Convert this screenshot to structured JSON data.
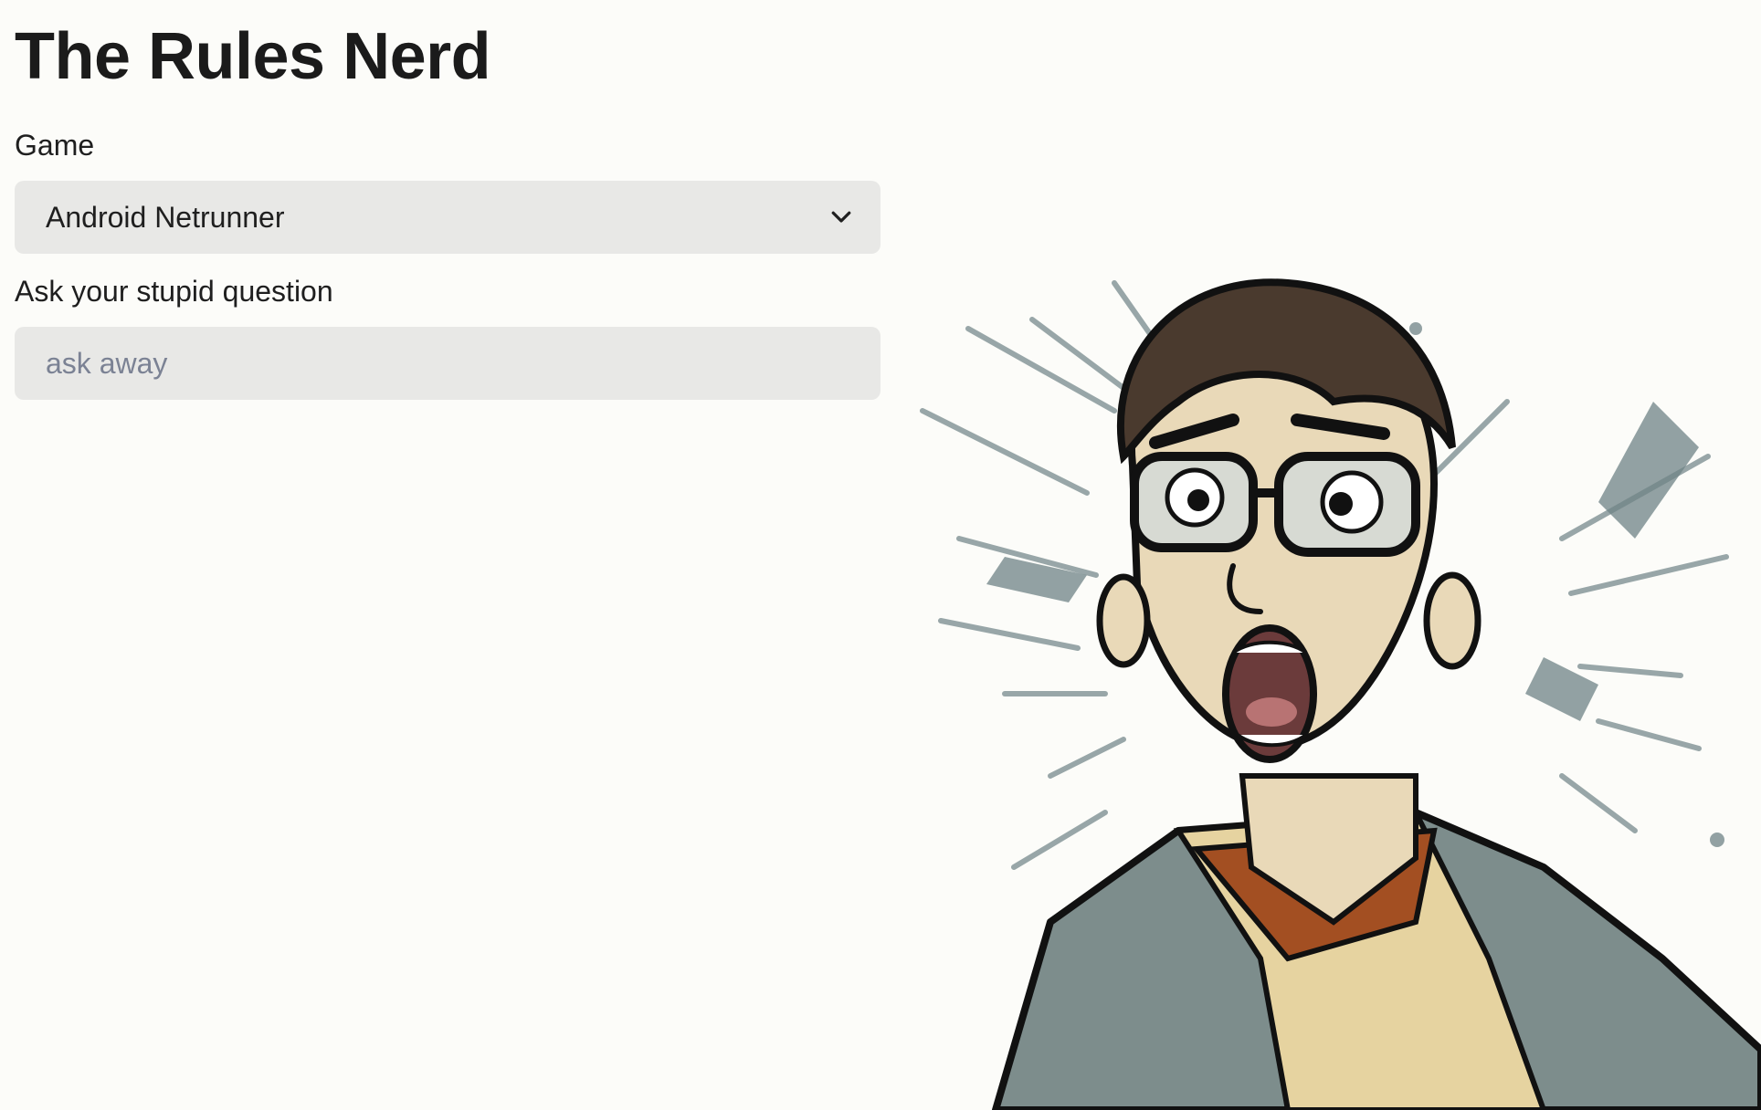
{
  "page": {
    "title": "The Rules Nerd"
  },
  "game_field": {
    "label": "Game",
    "selected": "Android Netrunner",
    "icon": "chevron-down-icon"
  },
  "question_field": {
    "label": "Ask your stupid question",
    "value": "",
    "placeholder": "ask away"
  },
  "illustration": {
    "subject": "shocked nerd with glasses",
    "colors": {
      "hair": "#4a3a2e",
      "skin": "#e9d9b8",
      "shirt": "#7d8d8c",
      "tee": "#e6d3a0",
      "collar": "#a34f22",
      "burst": "#6f8386"
    }
  },
  "theme": {
    "background": "#fcfcf9",
    "field_bg": "#e8e8e6",
    "placeholder": "#7b8294"
  }
}
